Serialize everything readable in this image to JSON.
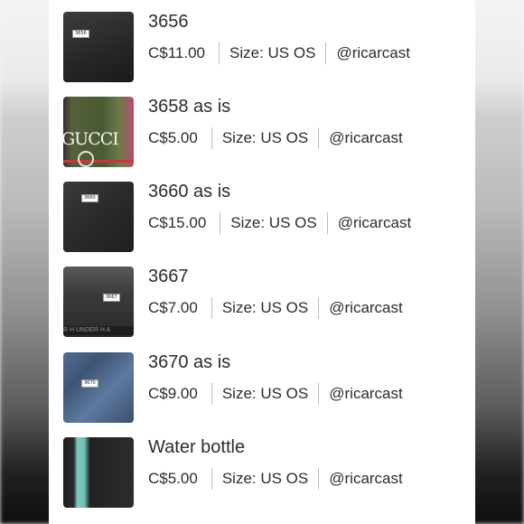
{
  "items": [
    {
      "title": "3656",
      "price": "C$11.00",
      "size": "Size: US OS",
      "seller": "@ricarcast",
      "thumb_tag": "3656"
    },
    {
      "title": "3658 as is",
      "price": "C$5.00",
      "size": "Size: US OS",
      "seller": "@ricarcast",
      "thumb_tag": "GUCCI"
    },
    {
      "title": "3660 as is",
      "price": "C$15.00",
      "size": "Size: US OS",
      "seller": "@ricarcast",
      "thumb_tag": "3660"
    },
    {
      "title": "3667",
      "price": "C$7.00",
      "size": "Size: US OS",
      "seller": "@ricarcast",
      "thumb_tag": "3667"
    },
    {
      "title": "3670 as is",
      "price": "C$9.00",
      "size": "Size: US OS",
      "seller": "@ricarcast",
      "thumb_tag": "3670"
    },
    {
      "title": "Water bottle",
      "price": "C$5.00",
      "size": "Size: US OS",
      "seller": "@ricarcast",
      "thumb_tag": ""
    }
  ],
  "thumb_extras": {
    "item4_band_text": "R H UNDER H A"
  }
}
